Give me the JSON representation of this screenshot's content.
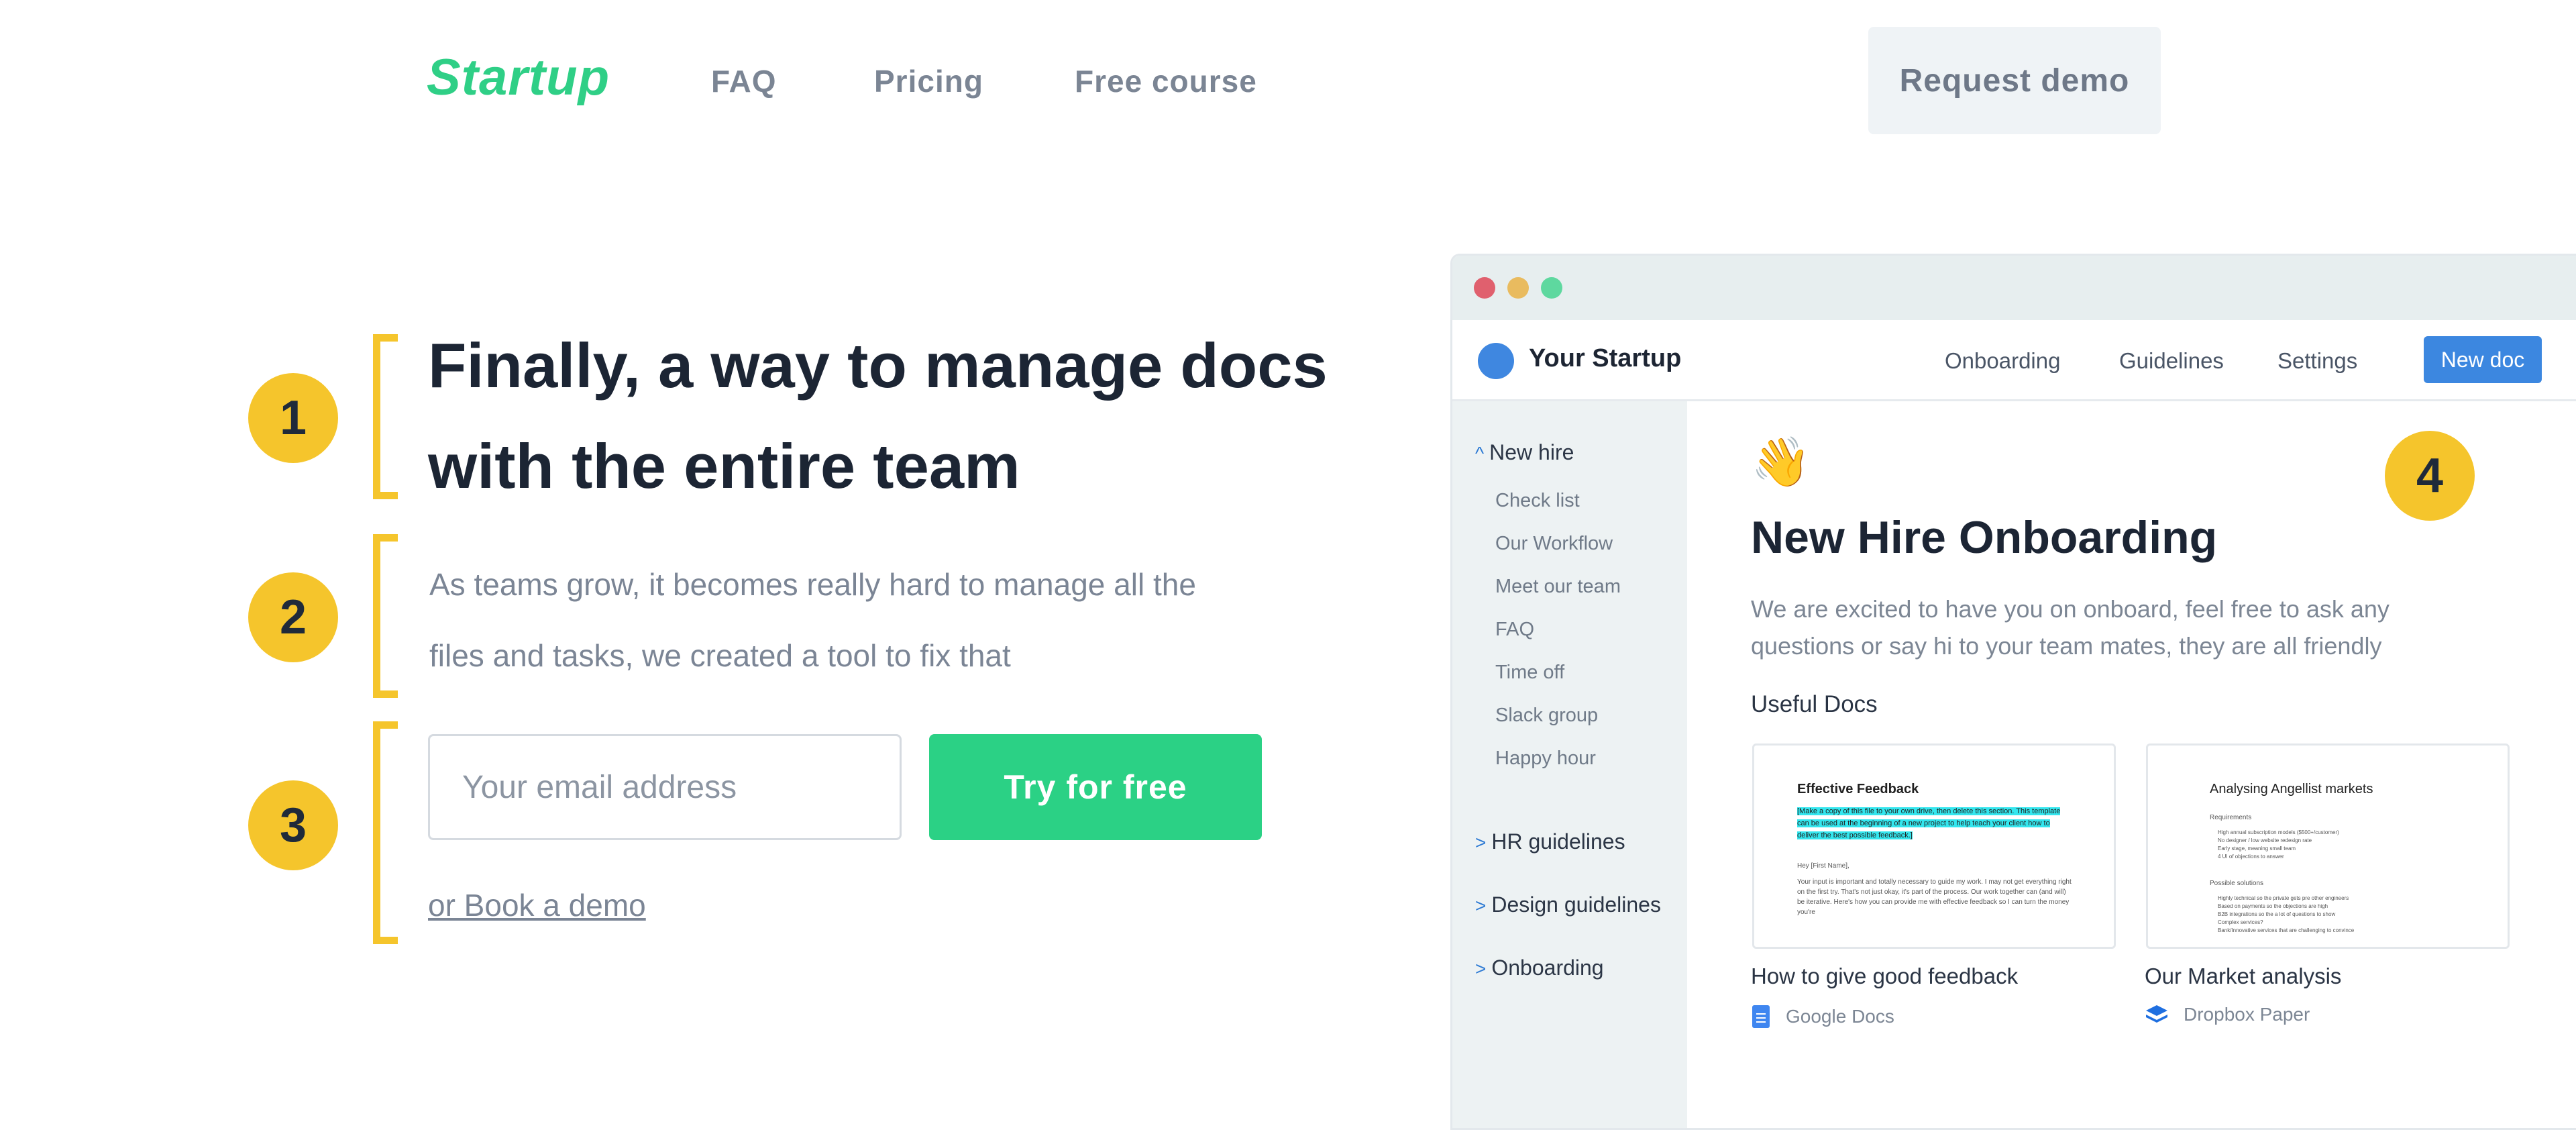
{
  "nav": {
    "logo": "Startup",
    "links": [
      "FAQ",
      "Pricing",
      "Free course"
    ],
    "request_demo": "Request demo"
  },
  "hero": {
    "headline_line1": "Finally, a way to manage docs",
    "headline_line2": "with the entire team",
    "subtext_line1": "As teams grow, it becomes really hard to manage all the",
    "subtext_line2": "files and tasks, we created a tool to fix that",
    "email_placeholder": "Your email address",
    "cta": "Try for free",
    "book_demo": "or Book a demo",
    "badges": [
      "1",
      "2",
      "3",
      "4"
    ]
  },
  "app": {
    "name": "Your Startup",
    "tabs": [
      "Onboarding",
      "Guidelines",
      "Settings"
    ],
    "new_doc": "New doc",
    "sidebar": {
      "expanded_section": "New hire",
      "expanded_chevron": "^",
      "items": [
        "Check list",
        "Our Workflow",
        "Meet our team",
        "FAQ",
        "Time off",
        "Slack group",
        "Happy hour"
      ],
      "collapsed_chevron": ">",
      "sections": [
        "HR guidelines",
        "Design guidelines",
        "Onboarding"
      ]
    },
    "content": {
      "emoji": "👋",
      "title": "New Hire Onboarding",
      "desc_line1": "We are excited to have you on onboard, feel free to ask any",
      "desc_line2": "questions or say hi to your team mates, they are all friendly",
      "useful_docs": "Useful Docs",
      "cards": [
        {
          "preview_title": "Effective Feedback",
          "preview_highlight": "[Make a copy of this file to your own drive, then delete this section. This template can be used at the beginning of a new project to help teach your client how to deliver the best possible feedback.]",
          "preview_greeting": "Hey [First Name],",
          "preview_body": "Your input is important and totally necessary to guide my work. I may not get everything right on the first try. That's not just okay, it's part of the process. Our work together can (and will) be iterative. Here's how you can provide me with effective feedback so I can turn the money you're",
          "caption": "How to give good feedback",
          "source": "Google Docs"
        },
        {
          "preview_title": "Analysing Angellist markets",
          "preview_req_heading": "Requirements",
          "preview_req": [
            "High annual subscription models ($500+/customer)",
            "No designer / low website redesign rate",
            "Early stage, meaning small team",
            "4 UI of objections to answer"
          ],
          "preview_sol_heading": "Possible solutions",
          "preview_sol": [
            "Highly technical so the private gets pre other engineers",
            "Based on payments so the objections are high",
            "B2B integrations so the a lot of questions to show",
            "Complex services?",
            "Bank/Innovative services that are challenging to convince"
          ],
          "caption": "Our Market analysis",
          "source": "Dropbox Paper"
        }
      ]
    }
  },
  "colors": {
    "brand_green": "#2fcf86",
    "badge_yellow": "#f5c52c",
    "app_blue": "#3c87e0",
    "traffic_red": "#e0606e",
    "traffic_yellow": "#e9bb5f",
    "traffic_green": "#5ed89f"
  }
}
